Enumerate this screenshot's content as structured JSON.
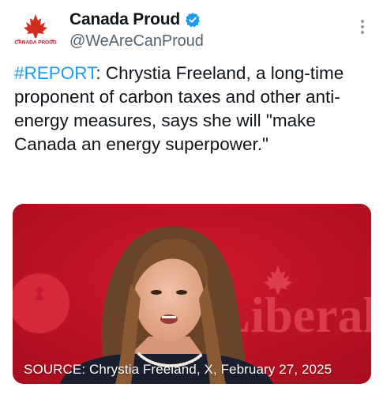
{
  "account": {
    "display_name": "Canada Proud",
    "handle": "@WeAreCanProud",
    "avatar_label": "CANADA PROUD",
    "verified_icon": "verified-badge-icon"
  },
  "post": {
    "hashtag": "#REPORT",
    "body": ": Chrystia Freeland, a long-time proponent of carbon taxes and other anti-energy measures, says she will \"make Canada an energy superpower.\""
  },
  "media": {
    "caption": "SOURCE: Chrystia Freeland, X, February 27, 2025",
    "background_word": "Liberal"
  },
  "colors": {
    "link": "#1d9bf0",
    "verified": "#1d9bf0",
    "brand_red": "#c8102e",
    "secondary_text": "#536471"
  }
}
